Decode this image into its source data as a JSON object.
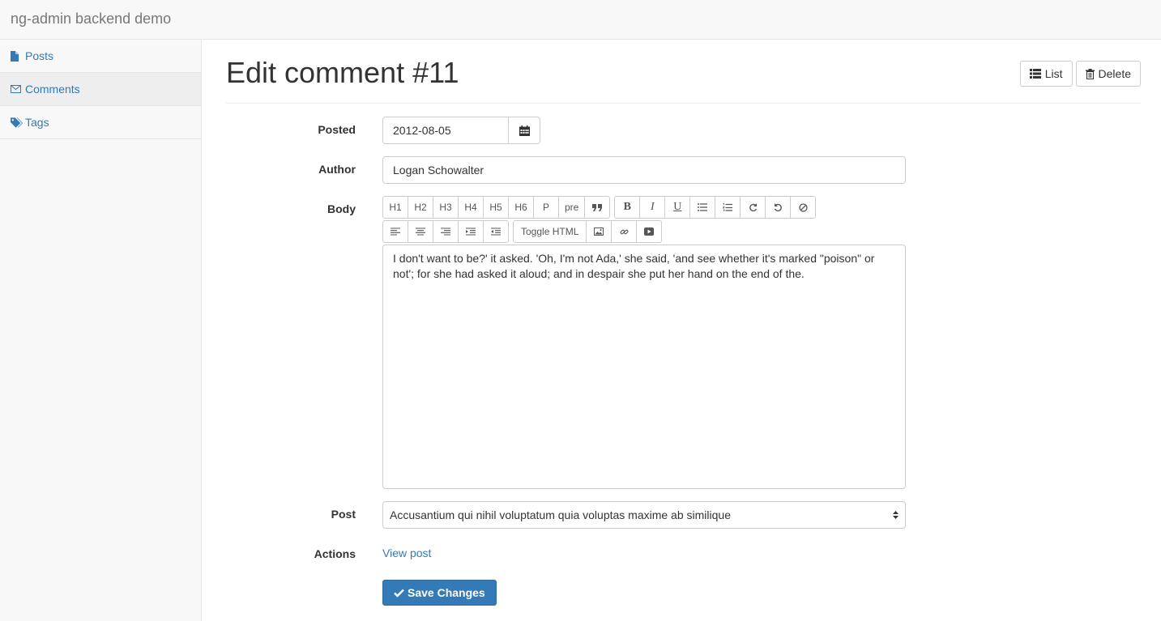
{
  "app": {
    "brand": "ng-admin backend demo"
  },
  "sidebar": {
    "items": [
      {
        "label": "Posts",
        "icon": "file-icon"
      },
      {
        "label": "Comments",
        "icon": "envelope-icon",
        "active": true
      },
      {
        "label": "Tags",
        "icon": "tags-icon"
      }
    ]
  },
  "page": {
    "title": "Edit comment #11",
    "list_label": "List",
    "delete_label": "Delete"
  },
  "form": {
    "posted": {
      "label": "Posted",
      "value": "2012-08-05"
    },
    "author": {
      "label": "Author",
      "value": "Logan Schowalter"
    },
    "body": {
      "label": "Body",
      "toolbar_row1": [
        "H1",
        "H2",
        "H3",
        "H4",
        "H5",
        "H6",
        "P",
        "pre"
      ],
      "toggle_html": "Toggle HTML",
      "value": "I don't want to be?' it asked. 'Oh, I'm not Ada,' she said, 'and see whether it's marked \"poison\" or not'; for she had asked it aloud; and in despair she put her hand on the end of the."
    },
    "post": {
      "label": "Post",
      "value": "Accusantium qui nihil voluptatum quia voluptas maxime ab similique"
    },
    "actions": {
      "label": "Actions",
      "view_post": "View post"
    },
    "save_label": "Save Changes"
  }
}
